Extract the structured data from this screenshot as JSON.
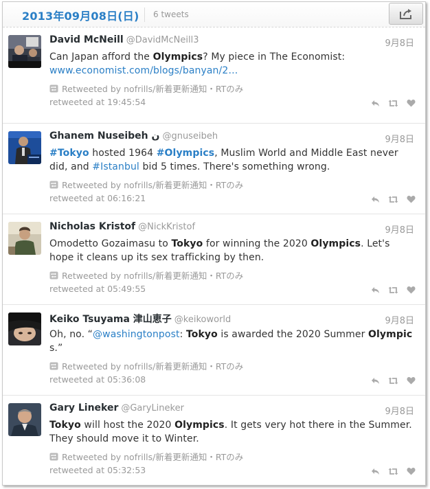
{
  "header": {
    "date": "2013年09月08日(日)",
    "tweet_count": "6 tweets",
    "share_icon": "share-icon"
  },
  "tweets": [
    {
      "name": "David McNeill",
      "handle": "@DavidMcNeill3",
      "date": "9月8日",
      "text_parts": [
        "Can Japan afford the ",
        "Olympics",
        "? My piece in The Economist:"
      ],
      "link": "www.economist.com/blogs/banyan/2…",
      "retweeted_by": "Retweeted by nofrills/新着更新通知・RTのみ",
      "retweet_time": "retweeted at 19:45:54"
    },
    {
      "name": "Ghanem Nuseibeh",
      "name_suffix": "ن",
      "handle": "@gnuseibeh",
      "date": "9月8日",
      "text_parts": [
        "#Tokyo",
        " hosted 1964 ",
        "#Olympics",
        ", Muslim World and Middle East never did, and ",
        "#Istanbul",
        " bid 5 times. There's something wrong."
      ],
      "retweeted_by": "Retweeted by nofrills/新着更新通知・RTのみ",
      "retweet_time": "retweeted at 06:16:21"
    },
    {
      "name": "Nicholas Kristof",
      "handle": "@NickKristof",
      "date": "9月8日",
      "text_parts": [
        "Omodetto Gozaimasu to ",
        "Tokyo",
        " for winning the 2020 ",
        "Olympics",
        ". Let's hope it cleans up its sex trafficking by then."
      ],
      "retweeted_by": "Retweeted by nofrills/新着更新通知・RTのみ",
      "retweet_time": "retweeted at 05:49:55"
    },
    {
      "name": "Keiko Tsuyama 津山恵子",
      "handle": "@keikoworld",
      "date": "9月8日",
      "text_parts": [
        "Oh, no. “",
        "@washingtonpost",
        ": ",
        "Tokyo",
        " is awarded the 2020 Summer ",
        "Olympic",
        "s.”"
      ],
      "retweeted_by": "Retweeted by nofrills/新着更新通知・RTのみ",
      "retweet_time": "retweeted at 05:36:08"
    },
    {
      "name": "Gary Lineker",
      "handle": "@GaryLineker",
      "date": "9月8日",
      "text_parts": [
        "Tokyo",
        " will host the 2020 ",
        "Olympics",
        ". It gets very hot there in the Summer. They should move it to Winter."
      ],
      "retweeted_by": "Retweeted by nofrills/新着更新通知・RTのみ",
      "retweet_time": "retweeted at 05:32:53"
    }
  ],
  "colors": {
    "accent": "#2a7fc6",
    "muted": "#999999",
    "text": "#333333"
  }
}
